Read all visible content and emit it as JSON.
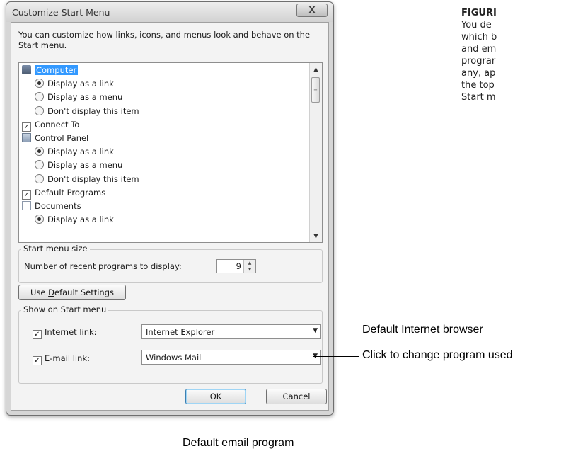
{
  "dialog": {
    "title": "Customize Start Menu",
    "close_label": "X",
    "description": "You can customize how links, icons, and menus look and behave on the Start menu.",
    "items": [
      {
        "type": "header",
        "icon": "computer-icon",
        "label": "Computer",
        "selected": true
      },
      {
        "type": "radio",
        "label": "Display as a link",
        "checked": true
      },
      {
        "type": "radio",
        "label": "Display as a menu",
        "checked": false
      },
      {
        "type": "radio",
        "label": "Don't display this item",
        "checked": false
      },
      {
        "type": "check",
        "label": "Connect To",
        "checked": true
      },
      {
        "type": "header",
        "icon": "control-panel-icon",
        "label": "Control Panel"
      },
      {
        "type": "radio",
        "label": "Display as a link",
        "checked": true
      },
      {
        "type": "radio",
        "label": "Display as a menu",
        "checked": false
      },
      {
        "type": "radio",
        "label": "Don't display this item",
        "checked": false
      },
      {
        "type": "check",
        "label": "Default Programs",
        "checked": true
      },
      {
        "type": "header",
        "icon": "documents-icon",
        "label": "Documents"
      },
      {
        "type": "radio",
        "label": "Display as a link",
        "checked": true
      }
    ],
    "start_menu_size": {
      "group_label": "Start menu size",
      "recent_label_accel": "N",
      "recent_label_rest": "umber of recent programs to display:",
      "recent_value": "9"
    },
    "default_settings": {
      "pre": "Use ",
      "accel": "D",
      "post": "efault Settings"
    },
    "show_on_start": {
      "group_label": "Show on Start menu",
      "internet": {
        "accel": "I",
        "rest": "nternet link:",
        "checked": true,
        "value": "Internet Explorer"
      },
      "email": {
        "accel": "E",
        "rest": "-mail link:",
        "checked": true,
        "value": "Windows Mail"
      }
    },
    "ok_label": "OK",
    "cancel_label": "Cancel"
  },
  "callouts": {
    "internet_browser": "Default Internet browser",
    "change_program": "Click to change program used",
    "email_program": "Default email program"
  },
  "figure_caption": {
    "title": "FIGURI",
    "lines": [
      "You de",
      "which b",
      "and em",
      "prograr",
      "any, ap",
      "the top",
      "Start m"
    ]
  }
}
